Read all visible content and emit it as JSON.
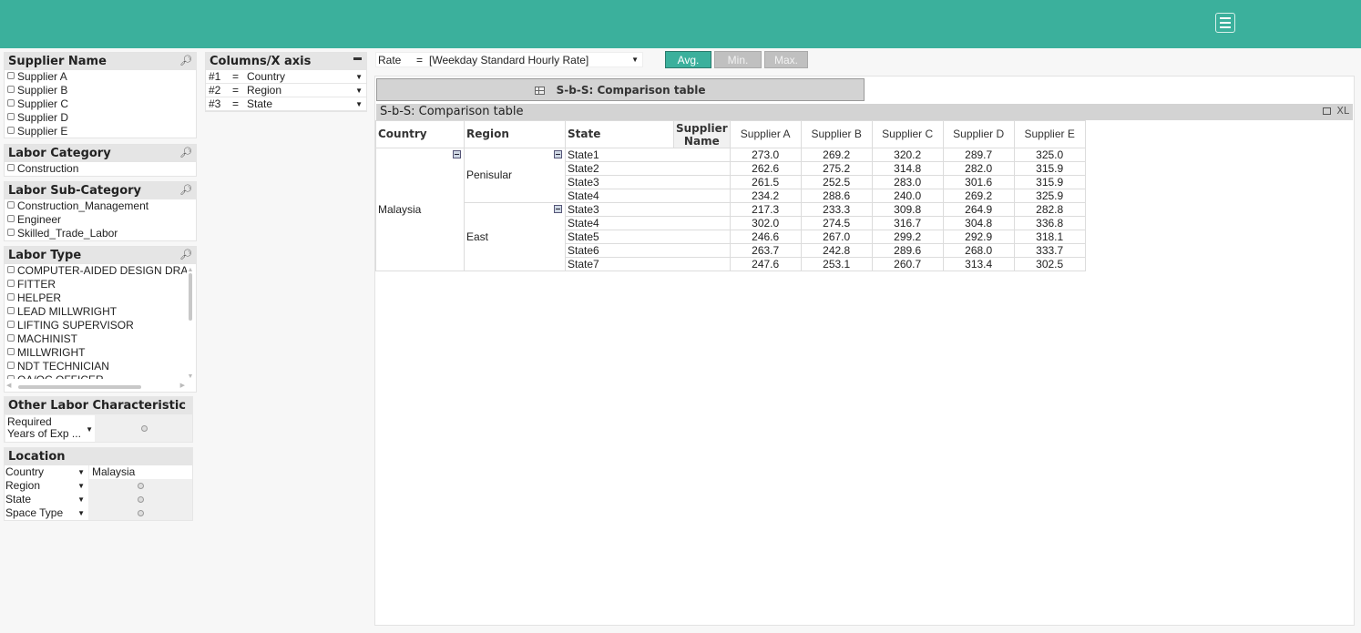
{
  "header": {
    "menu_icon": "hamburger-menu-icon"
  },
  "supplier_name": {
    "title": "Supplier Name",
    "items": [
      "Supplier A",
      "Supplier B",
      "Supplier C",
      "Supplier D",
      "Supplier E"
    ]
  },
  "labor_category": {
    "title": "Labor Category",
    "items": [
      "Construction"
    ]
  },
  "labor_sub_category": {
    "title": "Labor Sub-Category",
    "items": [
      "Construction_Management",
      "Engineer",
      "Skilled_Trade_Labor"
    ]
  },
  "labor_type": {
    "title": "Labor Type",
    "items": [
      "COMPUTER-AIDED DESIGN DRA",
      "FITTER",
      "HELPER",
      "LEAD MILLWRIGHT",
      "LIFTING SUPERVISOR",
      "MACHINIST",
      "MILLWRIGHT",
      "NDT TECHNICIAN",
      "QA/QC OFFICER"
    ]
  },
  "other_labor": {
    "title": "Other Labor Characteristic",
    "field_line1": "Required",
    "field_line2": "Years of Exp ..."
  },
  "location": {
    "title": "Location",
    "rows": [
      {
        "label": "Country",
        "value": "Malaysia"
      },
      {
        "label": "Region",
        "value": ""
      },
      {
        "label": "State",
        "value": ""
      },
      {
        "label": "Space Type",
        "value": ""
      }
    ]
  },
  "columns_axis": {
    "title": "Columns/X axis",
    "minimize": "▬",
    "rows": [
      {
        "key": "#1",
        "eq": "=",
        "value": "Country"
      },
      {
        "key": "#2",
        "eq": "=",
        "value": "Region"
      },
      {
        "key": "#3",
        "eq": "=",
        "value": "State"
      }
    ]
  },
  "rate": {
    "label": "Rate",
    "eq": "=",
    "value": "[Weekday Standard Hourly Rate]"
  },
  "agg_buttons": {
    "avg": "Avg.",
    "min": "Min.",
    "max": "Max."
  },
  "tab_button": {
    "label": "S-b-S: Comparison table"
  },
  "table": {
    "title": "S-b-S: Comparison table",
    "actions": "XL",
    "headers": {
      "country": "Country",
      "region": "Region",
      "state": "State",
      "supplier_name_1": "Supplier",
      "supplier_name_2": "Name",
      "suppliers": [
        "Supplier A",
        "Supplier B",
        "Supplier C",
        "Supplier D",
        "Supplier E"
      ]
    },
    "country": "Malaysia",
    "regions": [
      {
        "name": "Penisular",
        "rows": [
          {
            "state": "State1",
            "values": [
              "273.0",
              "269.2",
              "320.2",
              "289.7",
              "325.0"
            ]
          },
          {
            "state": "State2",
            "values": [
              "262.6",
              "275.2",
              "314.8",
              "282.0",
              "315.9"
            ]
          },
          {
            "state": "State3",
            "values": [
              "261.5",
              "252.5",
              "283.0",
              "301.6",
              "315.9"
            ]
          },
          {
            "state": "State4",
            "values": [
              "234.2",
              "288.6",
              "240.0",
              "269.2",
              "325.9"
            ]
          }
        ]
      },
      {
        "name": "East",
        "rows": [
          {
            "state": "State3",
            "values": [
              "217.3",
              "233.3",
              "309.8",
              "264.9",
              "282.8"
            ]
          },
          {
            "state": "State4",
            "values": [
              "302.0",
              "274.5",
              "316.7",
              "304.8",
              "336.8"
            ]
          },
          {
            "state": "State5",
            "values": [
              "246.6",
              "267.0",
              "299.2",
              "292.9",
              "318.1"
            ]
          },
          {
            "state": "State6",
            "values": [
              "263.7",
              "242.8",
              "289.6",
              "268.0",
              "333.7"
            ]
          },
          {
            "state": "State7",
            "values": [
              "247.6",
              "253.1",
              "260.7",
              "313.4",
              "302.5"
            ]
          }
        ]
      }
    ]
  }
}
